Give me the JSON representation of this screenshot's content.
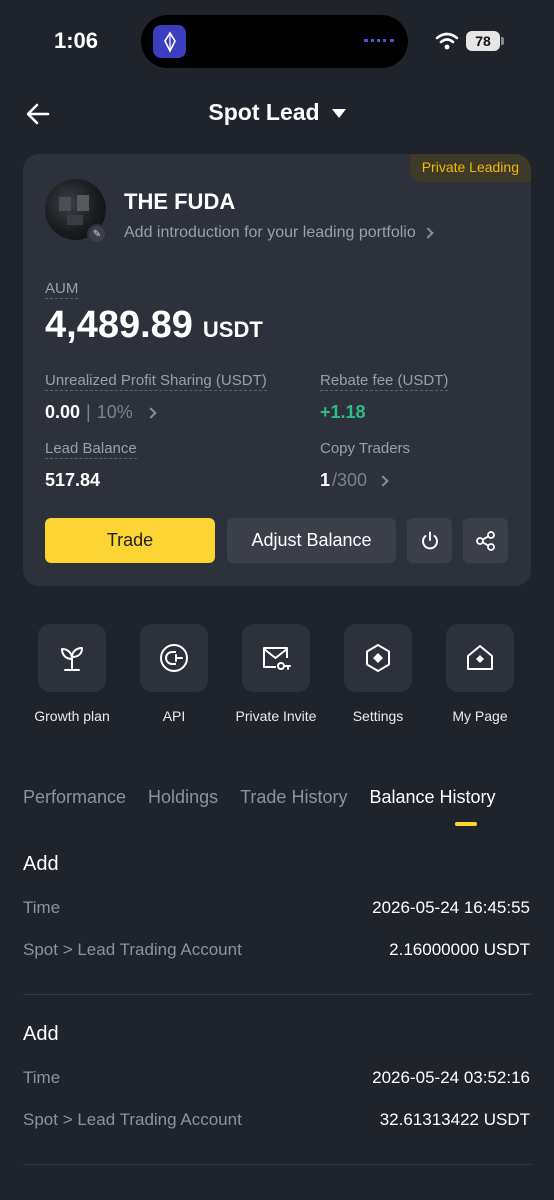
{
  "status_bar": {
    "time": "1:06",
    "battery": "78"
  },
  "header": {
    "title": "Spot Lead"
  },
  "card": {
    "badge": "Private Leading",
    "name": "THE FUDA",
    "intro": "Add introduction for your leading portfolio",
    "aum_label": "AUM",
    "aum_value": "4,489.89",
    "aum_unit": "USDT",
    "unrealized_label": "Unrealized Profit Sharing (USDT)",
    "unrealized_value": "0.00",
    "unrealized_sep": "|",
    "unrealized_pct": "10%",
    "rebate_label": "Rebate fee (USDT)",
    "rebate_value": "+1.18",
    "lead_balance_label": "Lead Balance",
    "lead_balance_value": "517.84",
    "copy_traders_label": "Copy Traders",
    "copy_traders_value": "1",
    "copy_traders_max": "/300",
    "trade_button": "Trade",
    "adjust_button": "Adjust Balance"
  },
  "shortcuts": [
    {
      "label": "Growth plan",
      "icon": "sprout-icon"
    },
    {
      "label": "API",
      "icon": "api-icon"
    },
    {
      "label": "Private Invite",
      "icon": "mail-key-icon"
    },
    {
      "label": "Settings",
      "icon": "settings-icon"
    },
    {
      "label": "My Page",
      "icon": "home-icon"
    }
  ],
  "tabs": [
    {
      "label": "Performance"
    },
    {
      "label": "Holdings"
    },
    {
      "label": "Trade History"
    },
    {
      "label": "Balance History",
      "active": true
    }
  ],
  "records": [
    {
      "type": "Add",
      "time_label": "Time",
      "time": "2026-05-24 16:45:55",
      "route": "Spot > Lead Trading Account",
      "amount": "2.16000000 USDT"
    },
    {
      "type": "Add",
      "time_label": "Time",
      "time": "2026-05-24 03:52:16",
      "route": "Spot > Lead Trading Account",
      "amount": "32.61313422 USDT"
    }
  ],
  "colors": {
    "accent": "#fcd535",
    "positive": "#2ebd85",
    "background": "#1f232b",
    "card": "#2c313c"
  }
}
